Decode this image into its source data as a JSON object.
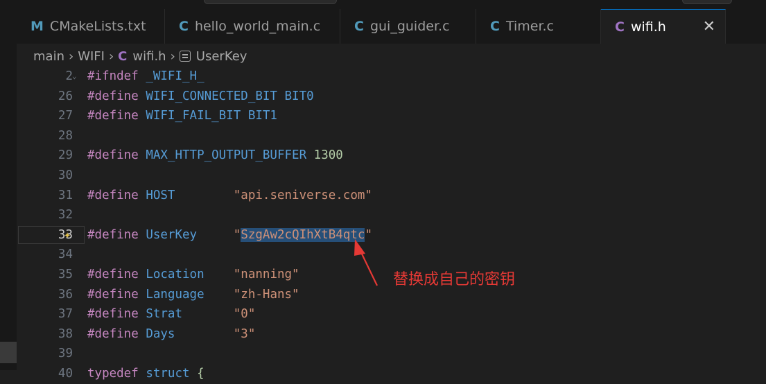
{
  "tabs": [
    {
      "icon": "M",
      "label": "CMakeLists.txt"
    },
    {
      "icon": "C",
      "label": "hello_world_main.c"
    },
    {
      "icon": "C",
      "label": "gui_guider.c"
    },
    {
      "icon": "C",
      "label": "Timer.c"
    },
    {
      "icon": "C",
      "label": "wifi.h",
      "close": "✕"
    }
  ],
  "breadcrumb": {
    "folder1": "main",
    "folder2": "WIFI",
    "file_icon": "C",
    "file": "wifi.h",
    "symbol": "UserKey"
  },
  "code": [
    {
      "ln": "2",
      "kw": "#ifndef",
      "name": "_WIFI_H_",
      "val": ""
    },
    {
      "ln": "26",
      "kw": "#define",
      "name": "WIFI_CONNECTED_BIT",
      "val": "BIT0"
    },
    {
      "ln": "27",
      "kw": "#define",
      "name": "WIFI_FAIL_BIT",
      "val": "BIT1"
    },
    {
      "ln": "28",
      "kw": "",
      "name": "",
      "val": ""
    },
    {
      "ln": "29",
      "kw": "#define",
      "name": "MAX_HTTP_OUTPUT_BUFFER",
      "val": "1300"
    },
    {
      "ln": "30",
      "kw": "",
      "name": "",
      "val": ""
    },
    {
      "ln": "31",
      "kw": "#define",
      "name": "HOST",
      "val": "\"api.seniverse.com\""
    },
    {
      "ln": "32",
      "kw": "",
      "name": "",
      "val": ""
    },
    {
      "ln": "33",
      "kw": "#define",
      "name": "UserKey",
      "val_open": "\"",
      "val_sel": "SzgAw2cQIhXtB4qtc",
      "val_close": "\""
    },
    {
      "ln": "34",
      "kw": "",
      "name": "",
      "val": ""
    },
    {
      "ln": "35",
      "kw": "#define",
      "name": "Location",
      "val": "\"nanning\""
    },
    {
      "ln": "36",
      "kw": "#define",
      "name": "Language",
      "val": "\"zh-Hans\""
    },
    {
      "ln": "37",
      "kw": "#define",
      "name": "Strat",
      "val": "\"0\""
    },
    {
      "ln": "38",
      "kw": "#define",
      "name": "Days",
      "val": "\"3\""
    },
    {
      "ln": "39",
      "kw": "",
      "name": "",
      "val": ""
    },
    {
      "ln": "40",
      "kw": "typedef",
      "name": "struct",
      "val": "{"
    }
  ],
  "annotation": "替换成自己的密钥",
  "colors": {
    "accent": "#0078d4",
    "annotation": "#e53935",
    "selection": "#264f78"
  }
}
